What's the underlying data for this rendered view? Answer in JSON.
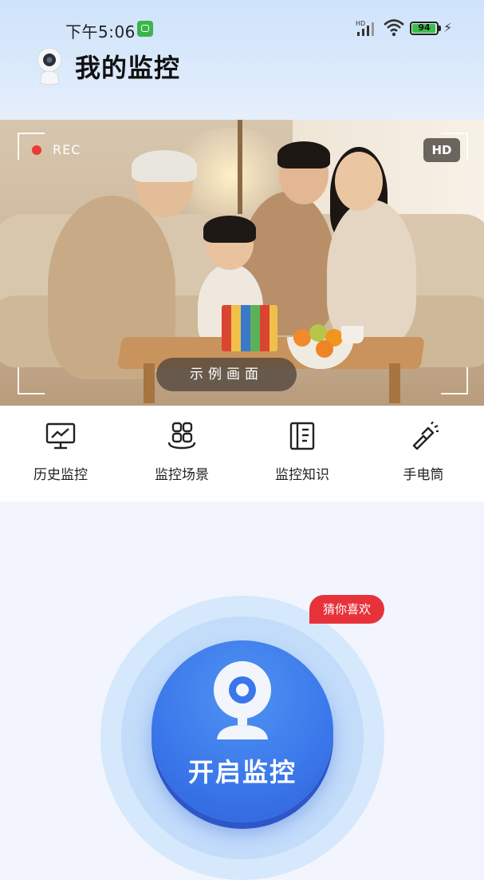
{
  "status_bar": {
    "time": "下午5:06",
    "network": "HD",
    "battery": "94"
  },
  "header": {
    "title": "我的监控"
  },
  "preview": {
    "rec_label": "REC",
    "hd_label": "HD",
    "sample_label": "示例画面"
  },
  "shortcuts": [
    {
      "label": "历史监控",
      "icon": "monitor-chart-icon"
    },
    {
      "label": "监控场景",
      "icon": "scene-grid-icon"
    },
    {
      "label": "监控知识",
      "icon": "knowledge-book-icon"
    },
    {
      "label": "手电筒",
      "icon": "flashlight-icon"
    }
  ],
  "main": {
    "promo_tag": "猜你喜欢",
    "start_label": "开启监控"
  },
  "colors": {
    "accent_blue": "#3a76ea",
    "rec_red": "#ea3a34",
    "tag_red": "#e8323a",
    "battery_green": "#3bbf4a"
  }
}
